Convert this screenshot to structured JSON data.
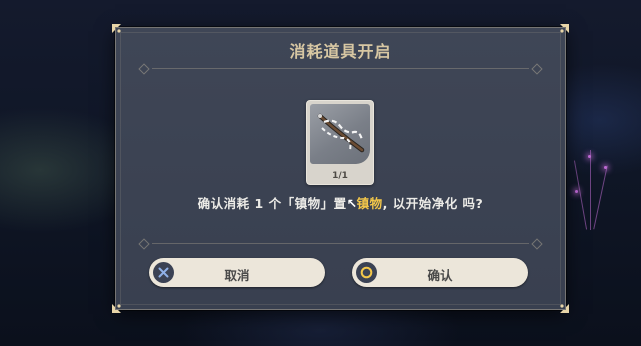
{
  "dialog": {
    "title": "消耗道具开启",
    "item": {
      "count": "1/1",
      "icon": "gouged-fang-item-icon"
    },
    "message": {
      "prefix": "确认消耗 1 个「镇物」置",
      "cursor": "↖",
      "highlight": "镇物",
      "suffix": ", 以开始净化 吗?"
    },
    "buttons": {
      "cancel_label": "取消",
      "cancel_icon": "cross-icon",
      "confirm_label": "确认",
      "confirm_icon": "circle-icon"
    }
  },
  "colors": {
    "title": "#d7c7a3",
    "highlight": "#f3c74a",
    "panel": "#3f4656",
    "button": "#ece6da",
    "cancel_icon": "#8fb0e8",
    "confirm_icon": "#f3c74a"
  }
}
